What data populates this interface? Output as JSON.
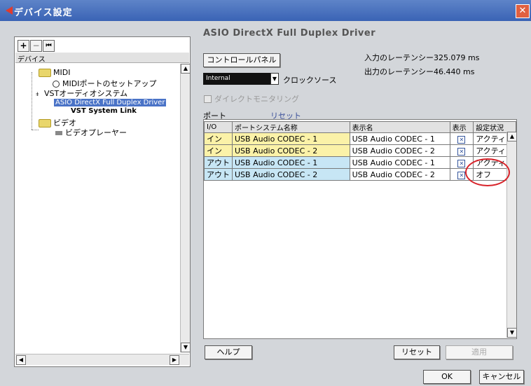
{
  "window": {
    "title": "デバイス設定",
    "close_label": "✕"
  },
  "toolbar": {
    "add_label": "+",
    "remove_label": "−",
    "reset_label": "⏮"
  },
  "tree": {
    "header": "デバイス",
    "items": [
      {
        "label": "MIDI"
      },
      {
        "label": "MIDIポートのセットアップ"
      },
      {
        "label": "VSTオーディオシステム"
      },
      {
        "label": "ASIO DirectX Full Duplex Driver"
      },
      {
        "label": "VST System Link"
      },
      {
        "label": "ビデオ"
      },
      {
        "label": "ビデオプレーヤー"
      }
    ]
  },
  "main": {
    "driver_title": "ASIO DirectX Full Duplex Driver",
    "control_panel_label": "コントロールパネル",
    "input_latency": "入力のレーテンシー325.079 ms",
    "output_latency": "出力のレーテンシー46.440 ms",
    "clock_source_value": "Internal",
    "clock_source_label": "クロックソース",
    "direct_monitoring_label": "ダイレクトモニタリング",
    "ports_label": "ポート",
    "reset_link": "リセット"
  },
  "ports_table": {
    "headers": [
      "I/O",
      "ポートシステム名称",
      "表示名",
      "表示",
      "設定状況"
    ],
    "rows": [
      {
        "io": "イン",
        "system_name": "USB Audio CODEC  - 1",
        "display_name": "USB Audio CODEC  - 1",
        "visible": "✕",
        "status": "アクティブ"
      },
      {
        "io": "イン",
        "system_name": "USB Audio CODEC  - 2",
        "display_name": "USB Audio CODEC  - 2",
        "visible": "✕",
        "status": "アクティブ"
      },
      {
        "io": "アウト",
        "system_name": "USB Audio CODEC  - 1",
        "display_name": "USB Audio CODEC  - 1",
        "visible": "✕",
        "status": "アクティブ"
      },
      {
        "io": "アウト",
        "system_name": "USB Audio CODEC  - 2",
        "display_name": "USB Audio CODEC  - 2",
        "visible": "✕",
        "status": "オフ"
      }
    ]
  },
  "bottom": {
    "help_label": "ヘルプ",
    "reset_label": "リセット",
    "apply_label": "適用",
    "ok_label": "OK",
    "cancel_label": "キャンセル"
  },
  "colors": {
    "title_bar": "#3a63b5",
    "input_row": "#fbf2a8",
    "output_row": "#c7e6f5",
    "highlight": "#d8232a"
  }
}
